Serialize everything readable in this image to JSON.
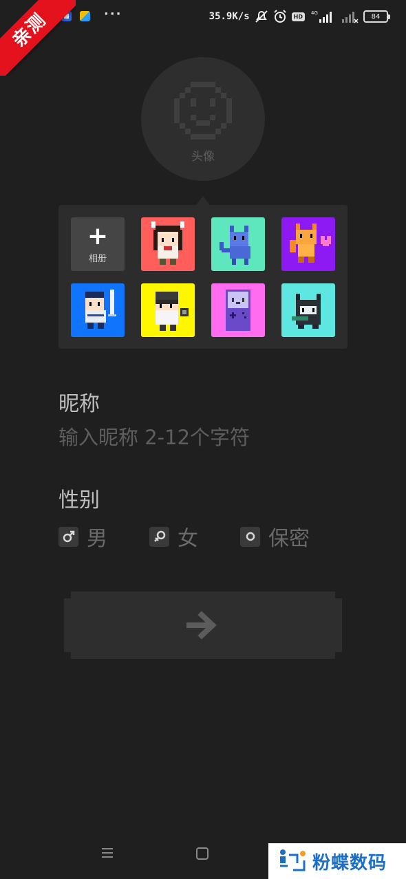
{
  "status_bar": {
    "net_speed": "35.9K/s",
    "hd_badge": "HD",
    "network_type": "4G",
    "battery": "84",
    "more": "···"
  },
  "ribbon": {
    "text": "亲测"
  },
  "avatar": {
    "label": "头像"
  },
  "picker": {
    "album_plus": "+",
    "album_label": "相册",
    "tile_colors": [
      "#ff5e5b",
      "#5ee7bd",
      "#8d1af2",
      "#1174fc",
      "#fff700",
      "#ff6cf0",
      "#5ee7e0"
    ]
  },
  "form": {
    "nickname_title": "昵称",
    "nickname_placeholder": "输入昵称 2-12个字符",
    "gender_title": "性别",
    "gender_options": [
      "男",
      "女",
      "保密"
    ]
  },
  "watermark": {
    "text": "粉蝶数码"
  }
}
